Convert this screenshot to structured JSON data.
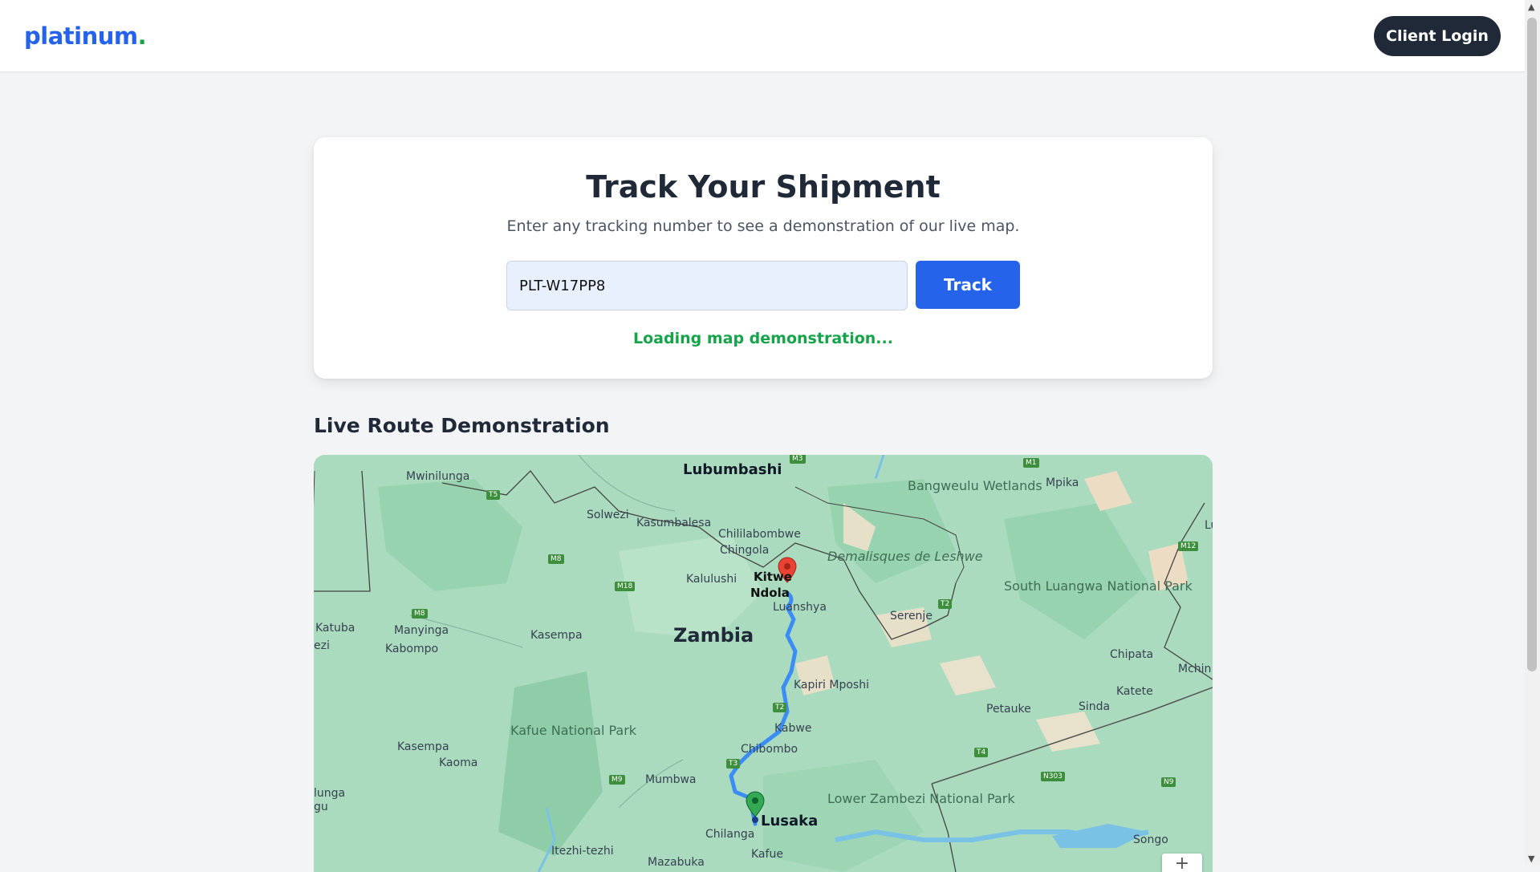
{
  "header": {
    "logo_text": "platinum",
    "logo_dot": ".",
    "login_label": "Client Login"
  },
  "tracker": {
    "title": "Track Your Shipment",
    "subtitle": "Enter any tracking number to see a demonstration of our live map.",
    "input_value": "PLT-W17PP8",
    "button_label": "Track",
    "status_text": "Loading map demonstration..."
  },
  "map_section": {
    "title": "Live Route Demonstration",
    "country_label": "Zambia",
    "labels": {
      "lubumbashi": "Lubumbashi",
      "mwinilunga": "Mwinilunga",
      "solwezi": "Solwezi",
      "kasumbalesa": "Kasumbalesa",
      "chililabombwe": "Chililabombwe",
      "chingola": "Chingola",
      "kalulushi": "Kalulushi",
      "kitwe": "Kitwe",
      "ndola": "Ndola",
      "luanshya": "Luanshya",
      "bangweulu": "Bangweulu Wetlands",
      "demalisques": "Demalisques de Leshwe",
      "mpika": "Mpika",
      "serenje": "Serenje",
      "south_luangwa": "South Luangwa National Park",
      "chipata": "Chipata",
      "mchin": "Mchin",
      "katete": "Katete",
      "petauke": "Petauke",
      "sinda": "Sinda",
      "katuba": "Katuba",
      "manyinga": "Manyinga",
      "kabompo": "Kabompo",
      "kasempa_n": "Kasempa",
      "kapiri": "Kapiri Mposhi",
      "kabwe": "Kabwe",
      "chibombo": "Chibombo",
      "kafue_np": "Kafue National Park",
      "kasempa_s": "Kasempa",
      "kaoma": "Kaoma",
      "mumbwa": "Mumbwa",
      "lusaka": "Lusaka",
      "chilanga": "Chilanga",
      "kafue": "Kafue",
      "lower_zambezi": "Lower Zambezi National Park",
      "itezhi": "Itezhi-tezhi",
      "mazabuka": "Mazabuka",
      "songo": "Songo",
      "lunga": "lunga",
      "gu": "gu",
      "ezi": "ezi",
      "lu": "Lu"
    },
    "roads": [
      "T5",
      "M8",
      "M18",
      "M8",
      "T2",
      "M3",
      "M1",
      "M12",
      "T2",
      "T4",
      "M9",
      "N303",
      "N9",
      "T3"
    ],
    "zoom_label": "+"
  },
  "colors": {
    "brand_blue": "#2563eb",
    "brand_green": "#16a34a",
    "dark": "#1f2937",
    "route": "#3b8cf5"
  }
}
